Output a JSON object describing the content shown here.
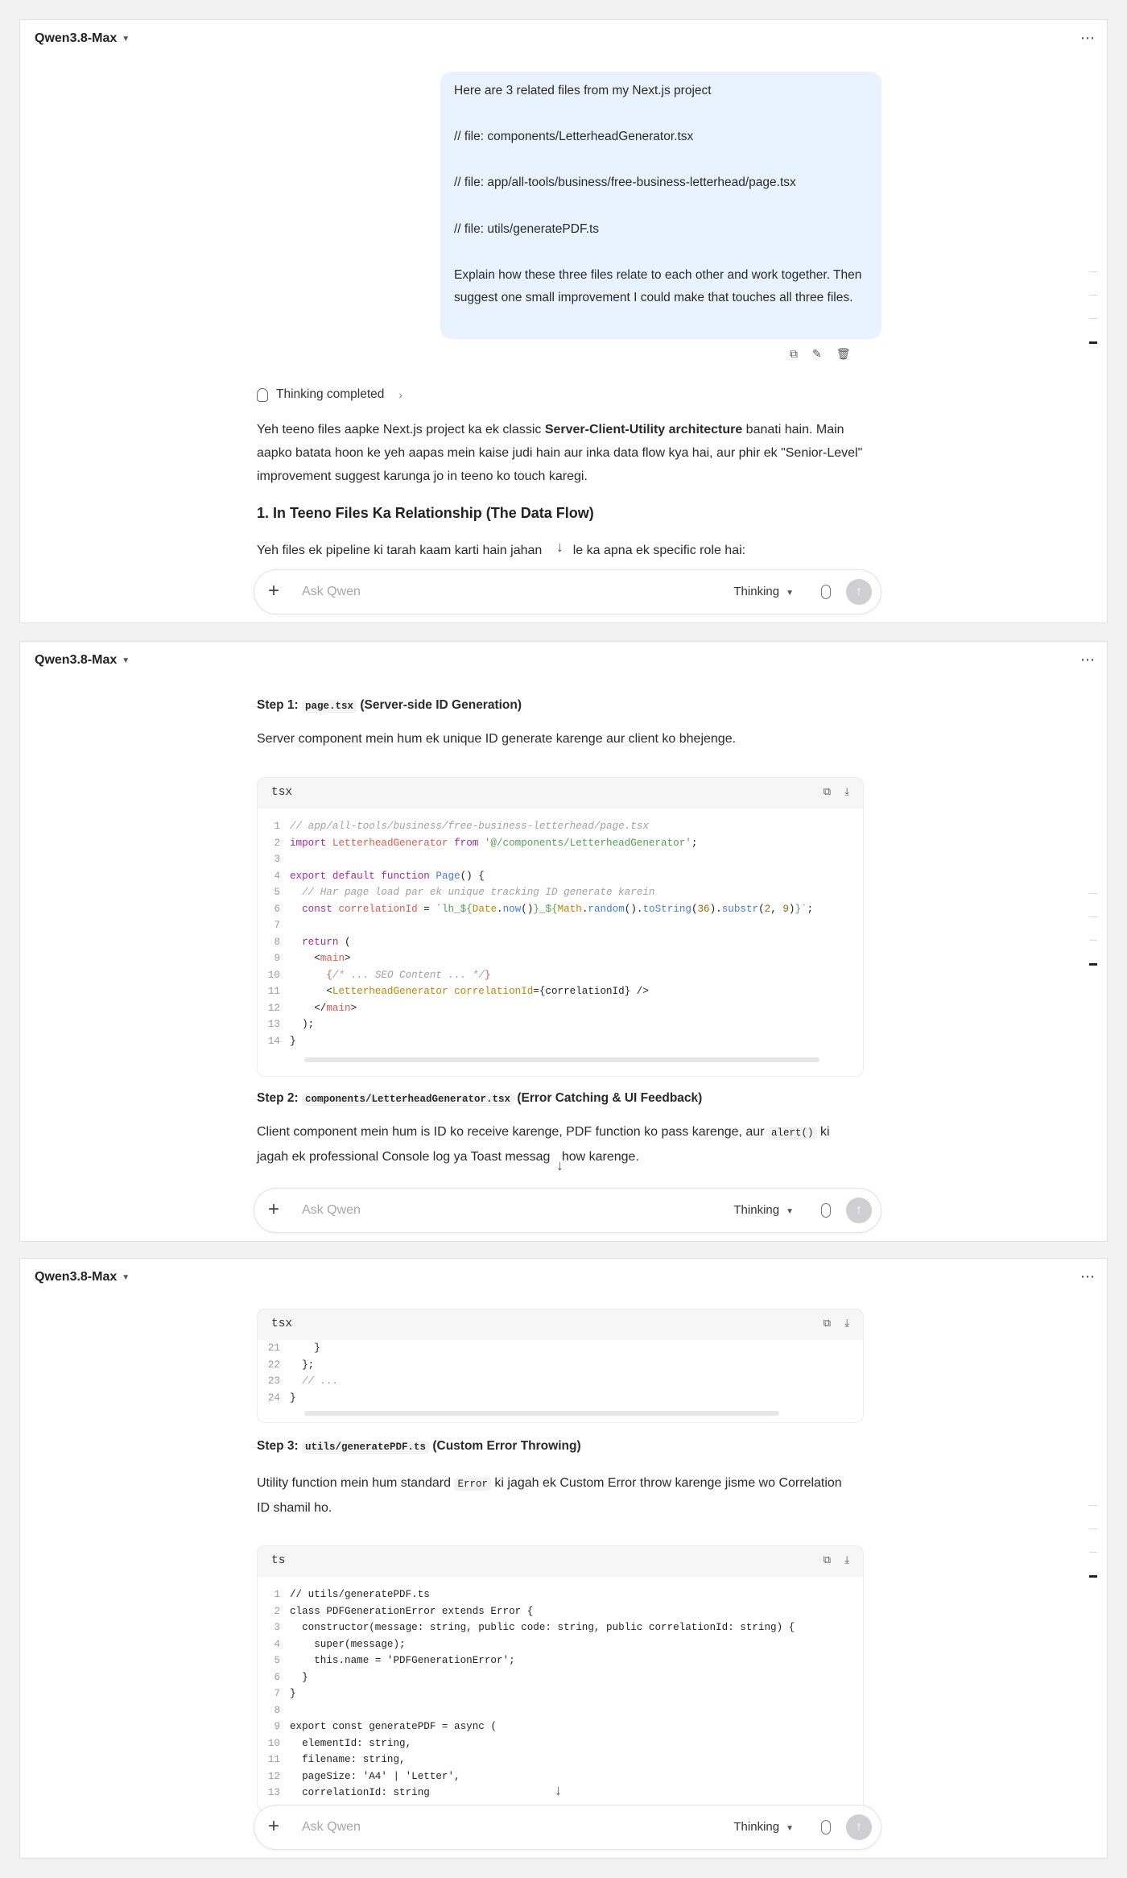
{
  "model_name": "Qwen3.8-Max",
  "input": {
    "placeholder": "Ask Qwen",
    "mode": "Thinking"
  },
  "panel1": {
    "user_message": [
      "Here are 3 related files from my Next.js project",
      "// file: components/LetterheadGenerator.tsx",
      "// file: app/all-tools/business/free-business-letterhead/page.tsx",
      "// file: utils/generatePDF.ts",
      "Explain how these three files relate to each other and work together. Then suggest one small improvement I could make that touches all three files."
    ],
    "thinking_label": "Thinking completed",
    "intro_a": "Yeh teeno files aapke Next.js project ka ek classic ",
    "intro_bold": "Server-Client-Utility architecture",
    "intro_b": " banati hain. Main aapko batata hoon ke yeh aapas mein kaise judi hain aur inka data flow kya hai, aur phir ek \"Senior-Level\" improvement suggest karunga jo in teeno ko touch karegi.",
    "heading": "1. In Teeno Files Ka Relationship (The Data Flow)",
    "pipeline_a": "Yeh files ek pipeline ki tarah kaam karti hain jahan",
    "pipeline_b": "le ka apna ek specific role hai:"
  },
  "panel2": {
    "step1_prefix": "Step 1:",
    "step1_file": "page.tsx",
    "step1_suffix": "(Server-side ID Generation)",
    "step1_desc": "Server component mein hum ek unique ID generate karenge aur client ko bhejenge.",
    "code_lang": "tsx",
    "step2_prefix": "Step 2:",
    "step2_file": "components/LetterheadGenerator.tsx",
    "step2_suffix": "(Error Catching & UI Feedback)",
    "step2_desc_a": "Client component mein hum is ID ko receive karenge, PDF function ko pass karenge, aur",
    "step2_code": "alert()",
    "step2_desc_b": "ki",
    "step2_desc_c_a": "jagah ek professional Console log ya Toast messag",
    "step2_desc_c_b": "how karenge."
  },
  "panel3": {
    "code_lang1": "tsx",
    "step3_prefix": "Step 3:",
    "step3_file": "utils/generatePDF.ts",
    "step3_suffix": "(Custom Error Throwing)",
    "step3_desc_a": "Utility function mein hum standard",
    "step3_code": "Error",
    "step3_desc_b": "ki jagah ek Custom Error throw karenge jisme wo Correlation",
    "step3_desc_c": "ID shamil ho.",
    "code_lang2": "ts"
  },
  "code1_lines": [
    "1",
    "2",
    "3",
    "4",
    "5",
    "6",
    "7",
    "8",
    "9",
    "10",
    "11",
    "12",
    "13",
    "14"
  ],
  "code2_lines": [
    "21",
    "22",
    "23",
    "24"
  ],
  "code3_lines": [
    "1",
    "2",
    "3",
    "4",
    "5",
    "6",
    "7",
    "8",
    "9",
    "10",
    "11",
    "12",
    "13"
  ]
}
